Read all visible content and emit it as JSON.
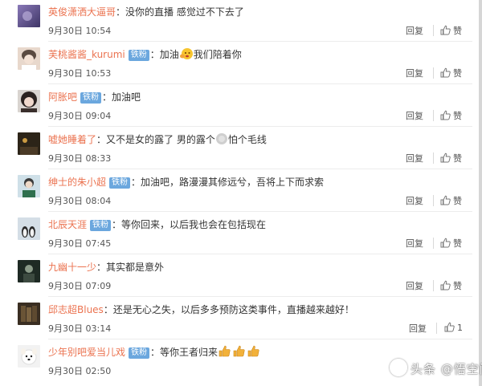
{
  "badge_label": "铁粉",
  "name_separator": "：",
  "reply_label": "回复",
  "like_label": "赞",
  "colors": {
    "username": "#eb7350",
    "badge": "#6ba7de",
    "text": "#333333",
    "meta": "#555555"
  },
  "comments": [
    {
      "username": "英俊潇洒大逼哥",
      "badge": false,
      "text": "没你的直播 感觉过不下去了",
      "time": "9月30日 10:54",
      "likes": ""
    },
    {
      "username": "芙桃酱酱_kurumi",
      "badge": true,
      "text_before": "加油",
      "emoji": "clap-face-emoji",
      "text_after": "我们陪着你",
      "time": "9月30日 10:53",
      "likes": ""
    },
    {
      "username": "阿胀吧",
      "badge": true,
      "text": "加油吧",
      "time": "9月30日 09:04",
      "likes": ""
    },
    {
      "username": "嘘她睡着了",
      "badge": false,
      "text_before": "又不是女的露了 男的露个",
      "emoji": "blurred-emoji",
      "text_after": "怕个毛线",
      "time": "9月30日 08:33",
      "likes": ""
    },
    {
      "username": "绅士的朱小超",
      "badge": true,
      "text": "加油吧，路漫漫其修远兮，吾将上下而求索",
      "time": "9月30日 08:04",
      "likes": ""
    },
    {
      "username": "北辰天涯",
      "badge": true,
      "text": "等你回来，以后我也会在包括现在",
      "time": "9月30日 07:45",
      "likes": ""
    },
    {
      "username": "九幽十一少",
      "badge": false,
      "text": "其实都是意外",
      "time": "9月30日 07:09",
      "likes": ""
    },
    {
      "username": "邱志超Blues",
      "badge": false,
      "text": "还是无心之失，以后多多预防这类事件，直播越来越好！",
      "time": "9月30日 03:14",
      "likes": "1"
    },
    {
      "username": "少年别吧爱当儿戏",
      "badge": true,
      "text": "等你王者归来",
      "emoji": "thumbs-up-emoji",
      "time": "9月30日 02:50",
      "likes": ""
    }
  ],
  "watermark": "头条 @悟空问答"
}
